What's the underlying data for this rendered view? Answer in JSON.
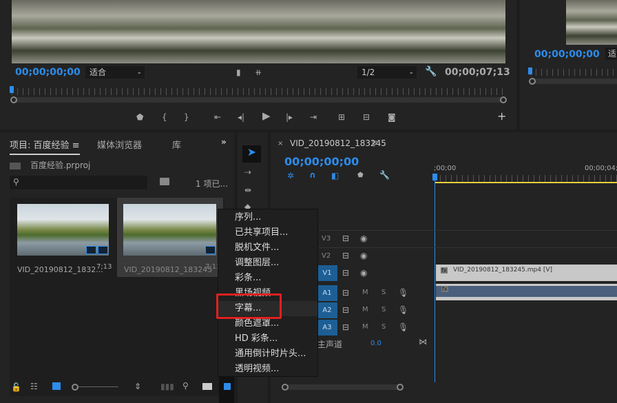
{
  "program_monitor": {
    "timecode_current": "00;00;00;00",
    "zoom_select": "适合",
    "resolution_select": "1/2",
    "timecode_duration": "00;00;07;13"
  },
  "source_monitor": {
    "timecode_current": "00;00;00;00",
    "zoom_select": "适"
  },
  "project_panel": {
    "tabs": [
      "项目: 百度经验",
      "媒体浏览器",
      "库"
    ],
    "project_file": "百度经验.prproj",
    "search_placeholder": "",
    "selection_count": "1 项已...",
    "items": [
      {
        "name": "VID_20190812_1832...",
        "duration": "7;13"
      },
      {
        "name": "VID_20190812_183245",
        "duration": "7;13"
      }
    ]
  },
  "context_menu": {
    "items": [
      "序列...",
      "已共享项目...",
      "脱机文件...",
      "调整图层...",
      "彩条...",
      "黑场视频...",
      "字幕...",
      "颜色遮罩...",
      "HD 彩条...",
      "通用倒计时片头...",
      "透明视频..."
    ],
    "highlighted": "字幕..."
  },
  "timeline": {
    "sequence_name": "VID_20190812_183245",
    "timecode": "00;00;00;00",
    "ruler_labels": [
      ";00;00",
      "00;00;04;"
    ],
    "video_tracks": [
      "V3",
      "V2",
      "V1"
    ],
    "audio_tracks": [
      "A1",
      "A2",
      "A3"
    ],
    "mute_label": "M",
    "solo_label": "S",
    "master_label": "主声道",
    "master_value": "0.0",
    "video_clip": "VID_20190812_183245.mp4 [V]",
    "fx_label": "fx"
  },
  "colors": {
    "accent": "#2d8ceb",
    "highlight_box": "#e02020",
    "work_area": "#e8d23a",
    "track_active": "#1d5f95"
  }
}
